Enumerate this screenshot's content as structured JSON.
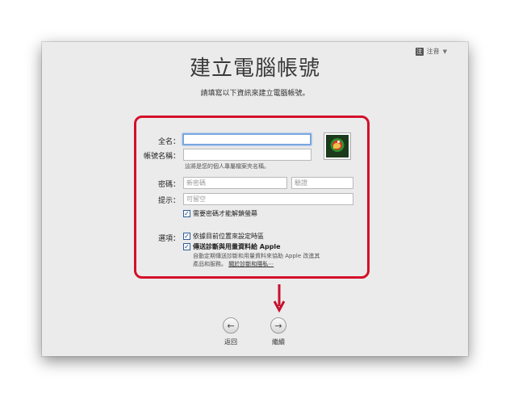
{
  "input_menu": {
    "icon": "input-method-icon",
    "icon_glyph": "注",
    "label": "注音"
  },
  "page": {
    "title": "建立電腦帳號",
    "subtitle": "請填寫以下資訊來建立電腦帳號。"
  },
  "form": {
    "full_name": {
      "label": "全名：",
      "value": ""
    },
    "account_name": {
      "label": "帳號名稱：",
      "value": "",
      "hint": "這將是您的個人專屬檔案夾名稱。"
    },
    "password": {
      "label": "密碼：",
      "new_placeholder": "新密碼",
      "verify_placeholder": "驗證"
    },
    "hint_field": {
      "label": "提示：",
      "placeholder": "可留空"
    },
    "require_password_unlock": {
      "label": "需要密碼才能解鎖螢幕",
      "checked": true
    },
    "options": {
      "label": "選項：",
      "set_timezone": {
        "label": "依據目前位置來設定時區",
        "checked": true
      },
      "send_diagnostics": {
        "label": "傳送診斷與用量資料給 Apple",
        "checked": true,
        "description_line1": "自動定期傳送診斷和用量資料來協助 Apple 改進其",
        "description_line2": "產品和服務。",
        "link": "關於診斷和隱私⋯"
      }
    }
  },
  "nav": {
    "back": {
      "icon": "back-arrow-icon",
      "glyph": "←",
      "label": "返回"
    },
    "continue": {
      "icon": "forward-arrow-icon",
      "glyph": "→",
      "label": "繼續"
    }
  },
  "colors": {
    "highlight": "#d4102b",
    "focus": "#7aa7e0",
    "background": "#ebebeb"
  }
}
